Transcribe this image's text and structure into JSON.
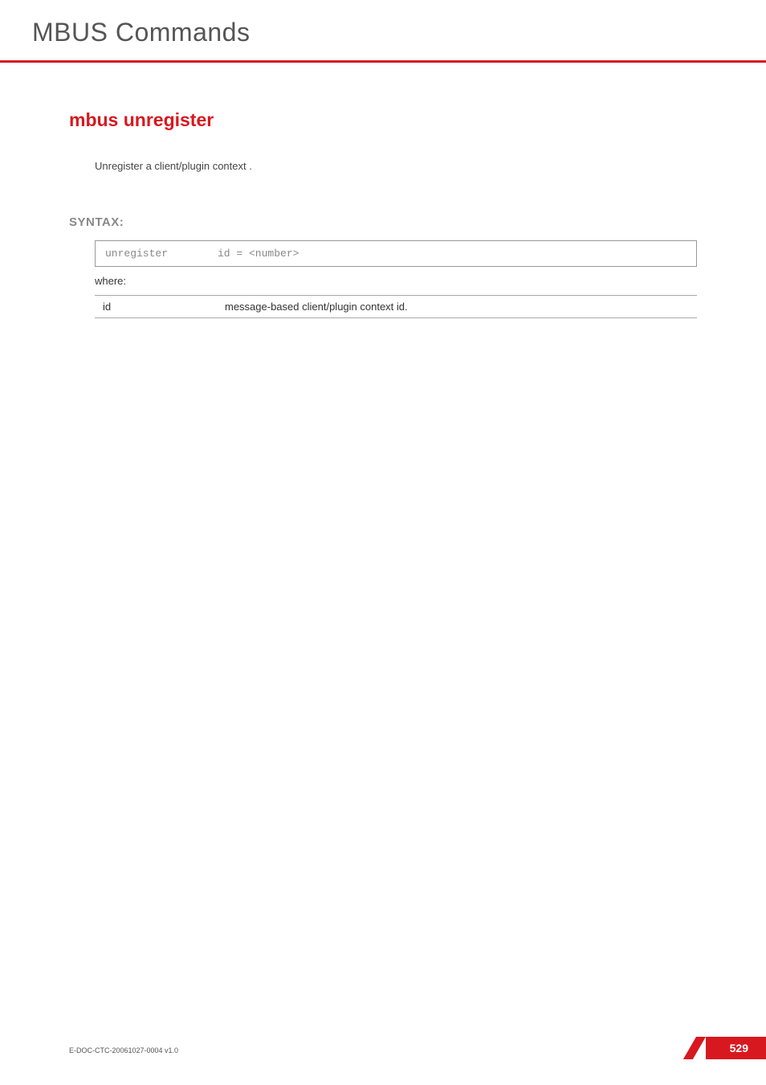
{
  "header": {
    "title": "MBUS Commands"
  },
  "command": {
    "title": "mbus unregister",
    "description": "Unregister a client/plugin context ."
  },
  "syntax": {
    "label": "SYNTAX:",
    "command": "unregister",
    "args": "id = <number>",
    "where_label": "where:",
    "params": [
      {
        "name": "id",
        "desc": "message-based client/plugin context id."
      }
    ]
  },
  "footer": {
    "doc_id": "E-DOC-CTC-20061027-0004 v1.0",
    "page_number": "529"
  }
}
